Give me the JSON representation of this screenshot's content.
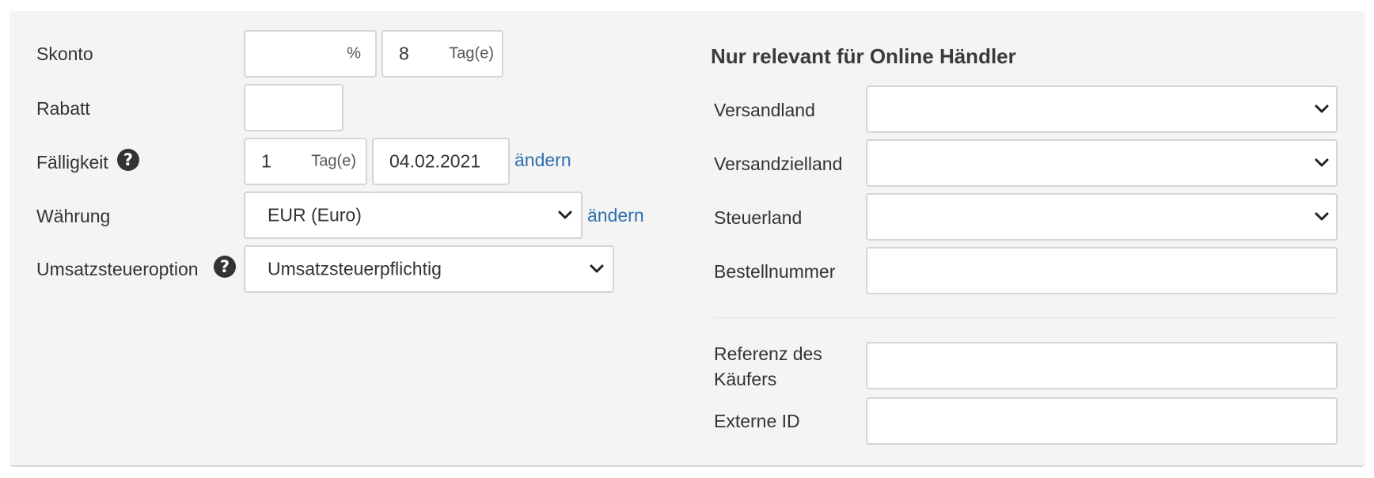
{
  "left": {
    "skonto": {
      "label": "Skonto",
      "percent_value": "",
      "percent_unit": "%",
      "days_value": "8",
      "days_unit": "Tag(e)"
    },
    "rabatt": {
      "label": "Rabatt",
      "value": ""
    },
    "faelligkeit": {
      "label": "Fälligkeit",
      "days_value": "1",
      "days_unit": "Tag(e)",
      "date_value": "04.02.2021",
      "change_link": "ändern"
    },
    "waehrung": {
      "label": "Währung",
      "selected": "EUR (Euro)",
      "change_link": "ändern"
    },
    "umsatzsteueroption": {
      "label": "Umsatzsteueroption",
      "selected": "Umsatzsteuerpflichtig"
    }
  },
  "right": {
    "heading": "Nur relevant für Online Händler",
    "versandland": {
      "label": "Versandland",
      "selected": ""
    },
    "versandzielland": {
      "label": "Versandzielland",
      "selected": ""
    },
    "steuerland": {
      "label": "Steuerland",
      "selected": ""
    },
    "bestellnummer": {
      "label": "Bestellnummer",
      "value": ""
    },
    "referenz": {
      "label_line1": "Referenz des",
      "label_line2": "Käufers",
      "value": ""
    },
    "externe_id": {
      "label": "Externe ID",
      "value": ""
    }
  },
  "icons": {
    "help": "question-circle-icon",
    "chevron": "chevron-down-icon"
  }
}
